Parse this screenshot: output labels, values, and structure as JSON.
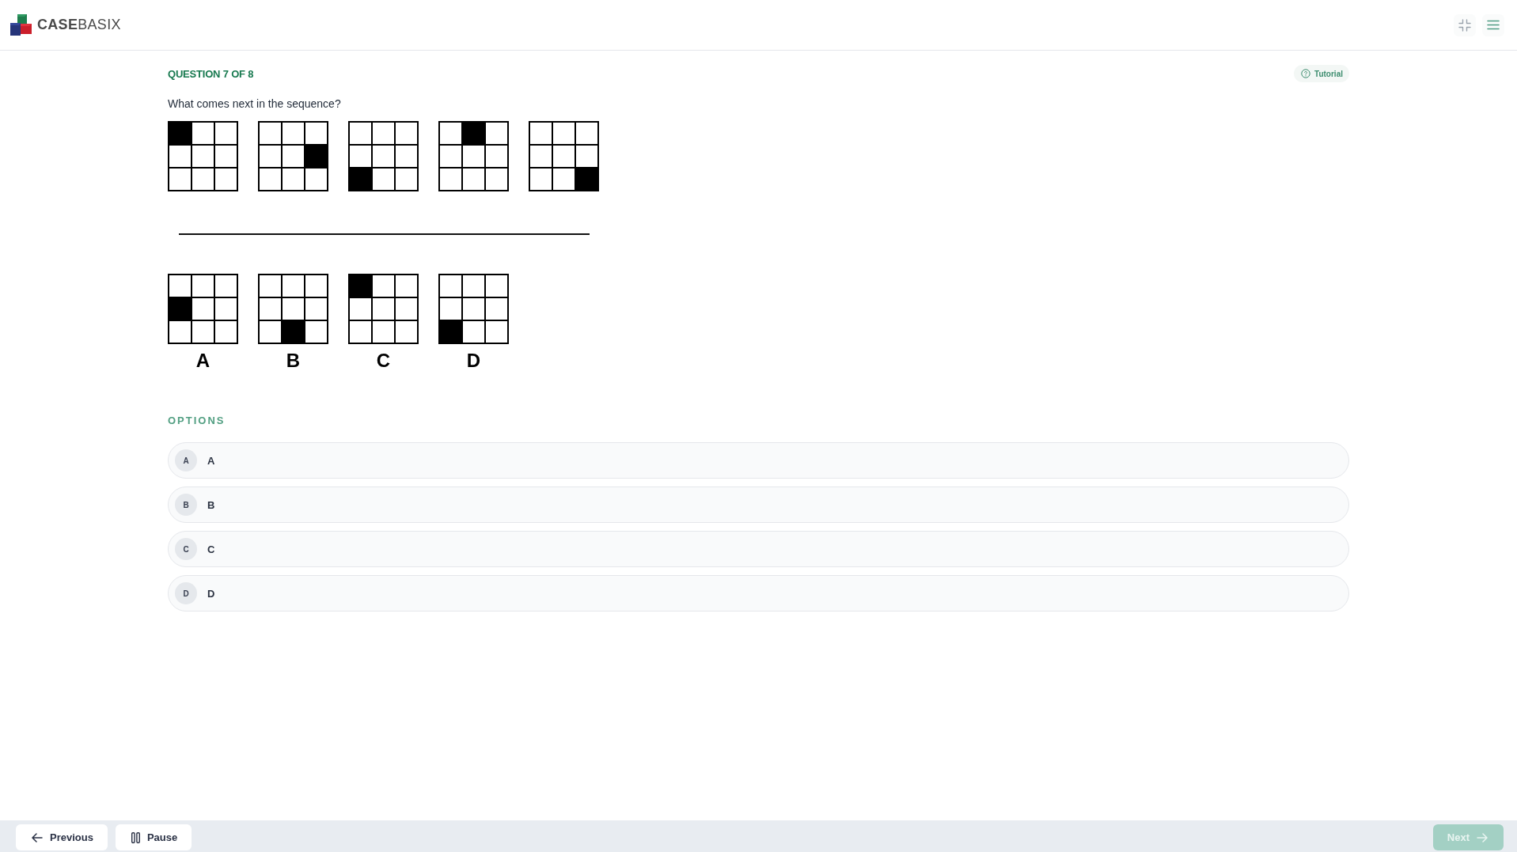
{
  "header": {
    "logo_text": "**CASE**BASIX"
  },
  "question": {
    "counter": "QUESTION 7 OF 8",
    "tutorial_label": "Tutorial",
    "prompt": "What comes next in the sequence?"
  },
  "sequence": [
    {
      "cells": [
        [
          true,
          false,
          false
        ],
        [
          false,
          false,
          false
        ],
        [
          false,
          false,
          false
        ]
      ]
    },
    {
      "cells": [
        [
          false,
          false,
          false
        ],
        [
          false,
          false,
          true
        ],
        [
          false,
          false,
          false
        ]
      ]
    },
    {
      "cells": [
        [
          false,
          false,
          false
        ],
        [
          false,
          false,
          false
        ],
        [
          true,
          false,
          false
        ]
      ]
    },
    {
      "cells": [
        [
          false,
          true,
          false
        ],
        [
          false,
          false,
          false
        ],
        [
          false,
          false,
          false
        ]
      ]
    },
    {
      "cells": [
        [
          false,
          false,
          false
        ],
        [
          false,
          false,
          false
        ],
        [
          false,
          false,
          true
        ]
      ]
    }
  ],
  "answer_figures": [
    {
      "label": "A",
      "cells": [
        [
          false,
          false,
          false
        ],
        [
          true,
          false,
          false
        ],
        [
          false,
          false,
          false
        ]
      ]
    },
    {
      "label": "B",
      "cells": [
        [
          false,
          false,
          false
        ],
        [
          false,
          false,
          false
        ],
        [
          false,
          true,
          false
        ]
      ]
    },
    {
      "label": "C",
      "cells": [
        [
          true,
          false,
          false
        ],
        [
          false,
          false,
          false
        ],
        [
          false,
          false,
          false
        ]
      ]
    },
    {
      "label": "D",
      "cells": [
        [
          false,
          false,
          false
        ],
        [
          false,
          false,
          false
        ],
        [
          true,
          false,
          false
        ]
      ]
    }
  ],
  "options": {
    "title": "OPTIONS",
    "items": [
      {
        "letter": "A",
        "label": "A",
        "selected": false
      },
      {
        "letter": "B",
        "label": "B",
        "selected": false
      },
      {
        "letter": "C",
        "label": "C",
        "selected": false
      },
      {
        "letter": "D",
        "label": "D",
        "selected": false
      }
    ]
  },
  "footer": {
    "buttons": [
      {
        "kind": "previous",
        "label": "Previous",
        "disabled": false
      },
      {
        "kind": "pause",
        "label": "Pause",
        "disabled": false
      },
      {
        "kind": "next",
        "label": "Next",
        "disabled": true
      }
    ]
  }
}
